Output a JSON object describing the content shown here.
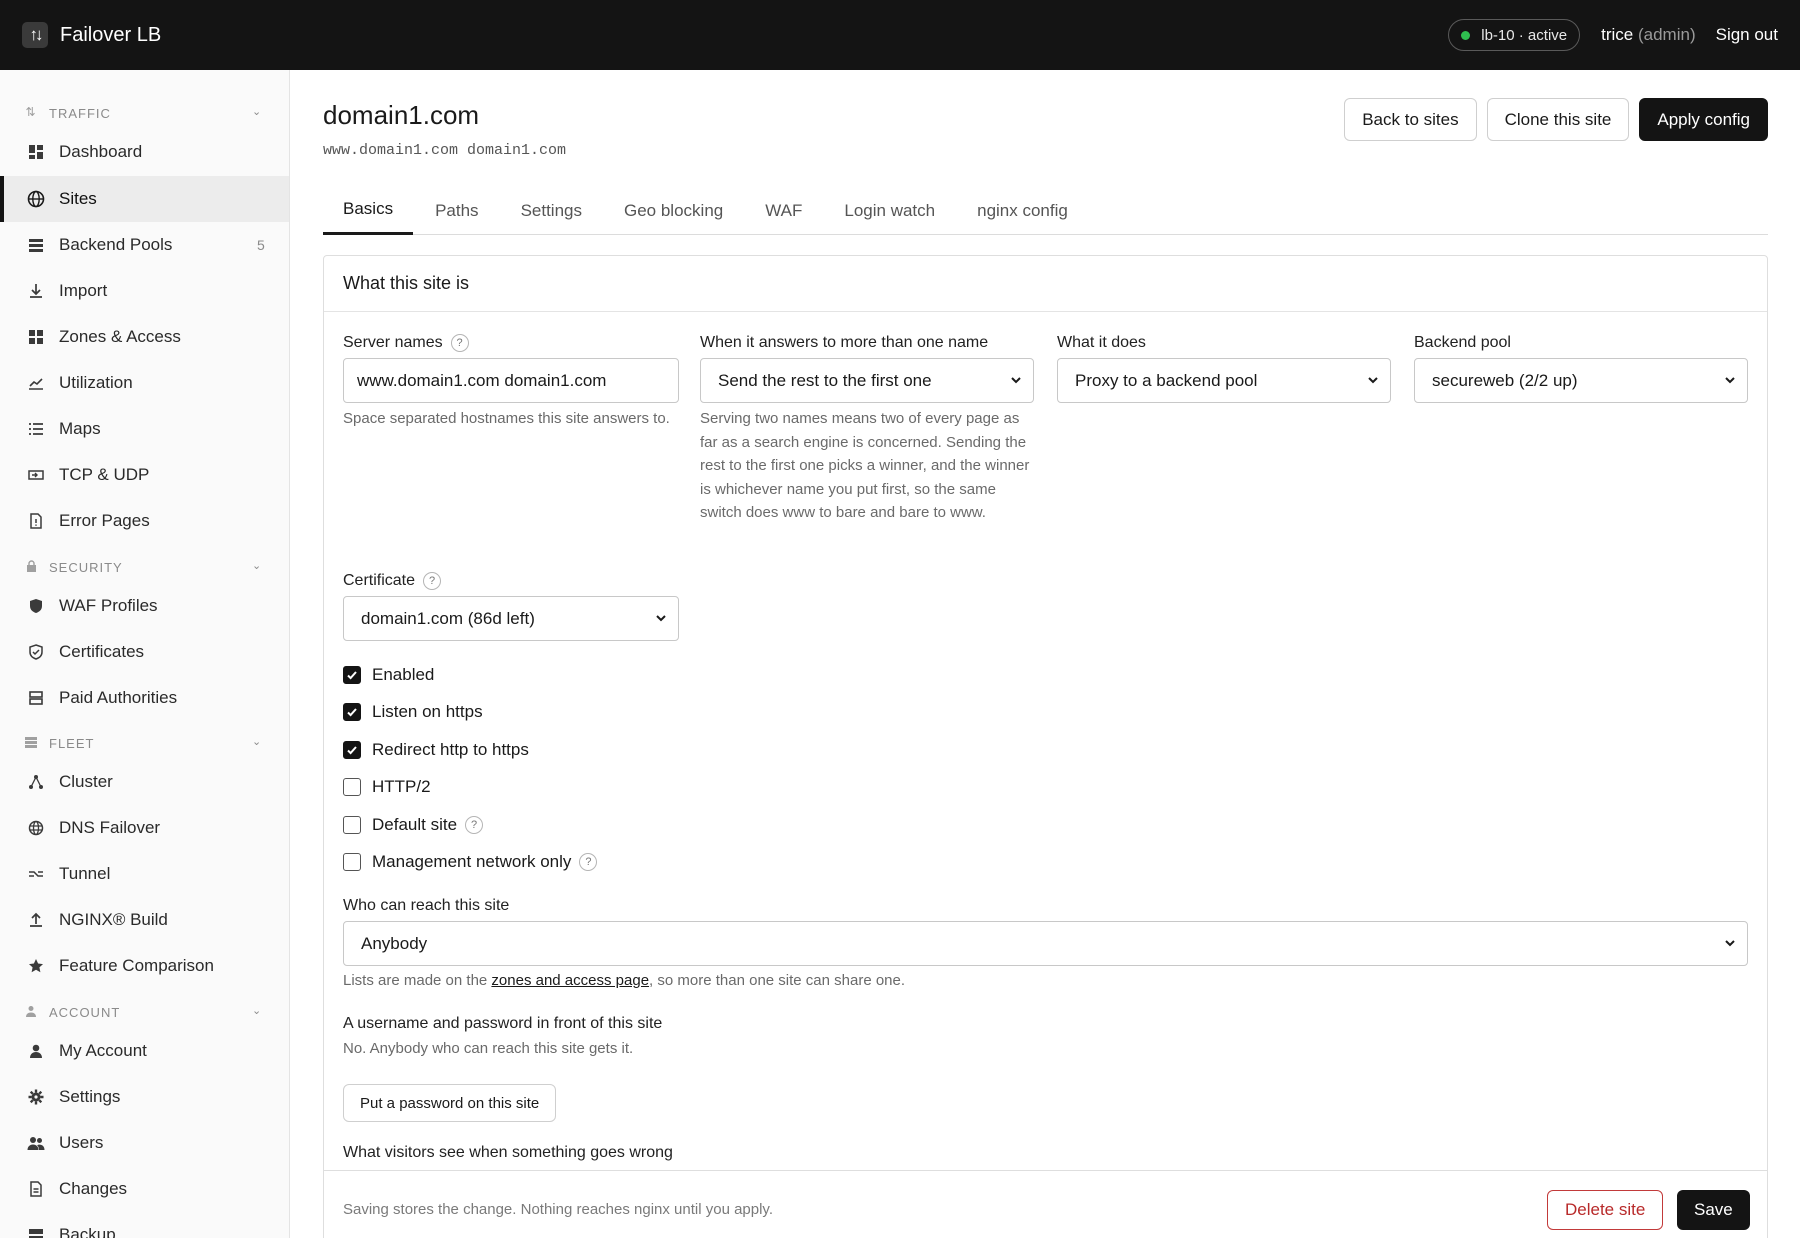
{
  "app": {
    "name": "Failover LB",
    "status": "lb-10 · active",
    "user": "trice",
    "role": "(admin)",
    "sign_out": "Sign out"
  },
  "sidebar": {
    "sections": [
      {
        "label": "TRAFFIC",
        "icon": "traffic-icon"
      },
      {
        "label": "SECURITY",
        "icon": "lock-icon"
      },
      {
        "label": "FLEET",
        "icon": "server-icon"
      },
      {
        "label": "ACCOUNT",
        "icon": "person-icon"
      }
    ],
    "items": [
      {
        "label": "Dashboard",
        "icon": "dashboard-icon"
      },
      {
        "label": "Sites",
        "icon": "globe-icon"
      },
      {
        "label": "Backend Pools",
        "icon": "pools-icon",
        "count": "5"
      },
      {
        "label": "Import",
        "icon": "download-icon"
      },
      {
        "label": "Zones & Access",
        "icon": "grid-icon"
      },
      {
        "label": "Utilization",
        "icon": "chart-icon"
      },
      {
        "label": "Maps",
        "icon": "list-icon"
      },
      {
        "label": "TCP & UDP",
        "icon": "port-icon"
      },
      {
        "label": "Error Pages",
        "icon": "file-alert-icon"
      },
      {
        "label": "WAF Profiles",
        "icon": "shield-filled-icon"
      },
      {
        "label": "Certificates",
        "icon": "shield-check-icon"
      },
      {
        "label": "Paid Authorities",
        "icon": "stack-icon"
      },
      {
        "label": "Cluster",
        "icon": "cluster-icon"
      },
      {
        "label": "DNS Failover",
        "icon": "dns-globe-icon"
      },
      {
        "label": "Tunnel",
        "icon": "tunnel-icon"
      },
      {
        "label": "NGINX® Build",
        "icon": "upload-icon"
      },
      {
        "label": "Feature Comparison",
        "icon": "star-icon"
      },
      {
        "label": "My Account",
        "icon": "user-icon"
      },
      {
        "label": "Settings",
        "icon": "gear-icon"
      },
      {
        "label": "Users",
        "icon": "users-icon"
      },
      {
        "label": "Changes",
        "icon": "document-icon"
      },
      {
        "label": "Backup",
        "icon": "backup-icon"
      }
    ]
  },
  "page": {
    "title": "domain1.com",
    "subtitle": "www.domain1.com domain1.com",
    "buttons": {
      "back": "Back to sites",
      "clone": "Clone this site",
      "apply": "Apply config"
    }
  },
  "tabs": [
    "Basics",
    "Paths",
    "Settings",
    "Geo blocking",
    "WAF",
    "Login watch",
    "nginx config"
  ],
  "card": {
    "title": "What this site is",
    "server_names": {
      "label": "Server names",
      "value": "www.domain1.com domain1.com",
      "hint": "Space separated hostnames this site answers to."
    },
    "multi_name": {
      "label": "When it answers to more than one name",
      "value": "Send the rest to the first one",
      "hint": "Serving two names means two of every page as far as a search engine is concerned. Sending the rest to the first one picks a winner, and the winner is whichever name you put first, so the same switch does www to bare and bare to www."
    },
    "what_it_does": {
      "label": "What it does",
      "value": "Proxy to a backend pool"
    },
    "backend_pool": {
      "label": "Backend pool",
      "value": "secureweb (2/2 up)"
    },
    "certificate": {
      "label": "Certificate",
      "value": "domain1.com (86d left)"
    },
    "checks": [
      {
        "label": "Enabled",
        "checked": true
      },
      {
        "label": "Listen on https",
        "checked": true
      },
      {
        "label": "Redirect http to https",
        "checked": true
      },
      {
        "label": "HTTP/2",
        "checked": false
      },
      {
        "label": "Default site",
        "checked": false
      },
      {
        "label": "Management network only",
        "checked": false
      }
    ],
    "reach": {
      "label": "Who can reach this site",
      "value": "Anybody",
      "hint_before": "Lists are made on the ",
      "hint_link": "zones and access page",
      "hint_after": ", so more than one site can share one."
    },
    "auth": {
      "label": "A username and password in front of this site",
      "hint": "No. Anybody who can reach this site gets it.",
      "button": "Put a password on this site"
    },
    "errors_label": "What visitors see when something goes wrong"
  },
  "footer": {
    "note": "Saving stores the change. Nothing reaches nginx until you apply.",
    "delete": "Delete site",
    "save": "Save"
  },
  "colors": {
    "topbar": "#141414",
    "status_dot": "#2fbf4f",
    "danger": "#b82a2a"
  }
}
